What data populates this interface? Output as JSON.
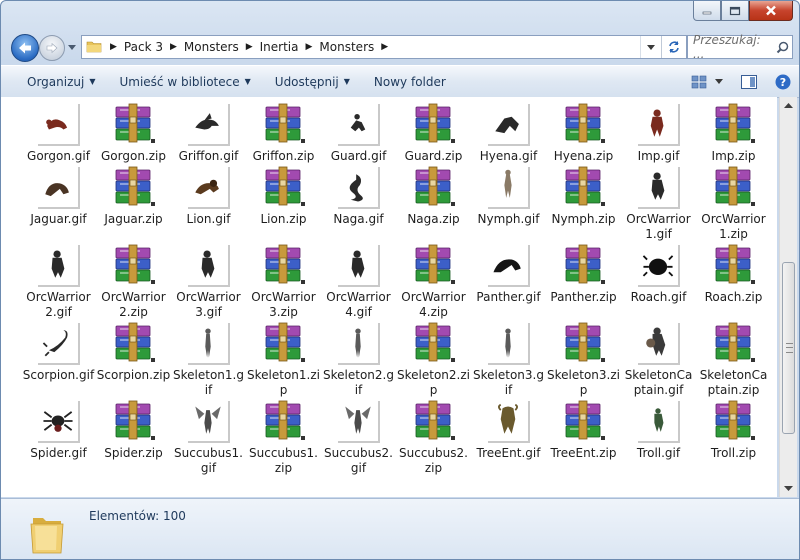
{
  "window": {
    "breadcrumb": [
      "Pack 3",
      "Monsters",
      "Inertia",
      "Monsters"
    ],
    "search_placeholder": "Przeszukaj: ...",
    "caption_buttons": [
      "minimize",
      "maximize",
      "close"
    ]
  },
  "toolbar": {
    "organize": "Organizuj",
    "library": "Umieść w bibliotece",
    "share": "Udostępnij",
    "new_folder": "Nowy folder"
  },
  "items": [
    {
      "label": "Gorgon.gif",
      "type": "gif",
      "icon": "gorgon-thumbnail"
    },
    {
      "label": "Gorgon.zip",
      "type": "zip",
      "icon": "winrar-archive-icon"
    },
    {
      "label": "Griffon.gif",
      "type": "gif",
      "icon": "griffon-thumbnail"
    },
    {
      "label": "Griffon.zip",
      "type": "zip",
      "icon": "winrar-archive-icon"
    },
    {
      "label": "Guard.gif",
      "type": "gif",
      "icon": "guard-thumbnail"
    },
    {
      "label": "Guard.zip",
      "type": "zip",
      "icon": "winrar-archive-icon"
    },
    {
      "label": "Hyena.gif",
      "type": "gif",
      "icon": "hyena-thumbnail"
    },
    {
      "label": "Hyena.zip",
      "type": "zip",
      "icon": "winrar-archive-icon"
    },
    {
      "label": "Imp.gif",
      "type": "gif",
      "icon": "imp-thumbnail"
    },
    {
      "label": "Imp.zip",
      "type": "zip",
      "icon": "winrar-archive-icon"
    },
    {
      "label": "Jaguar.gif",
      "type": "gif",
      "icon": "jaguar-thumbnail"
    },
    {
      "label": "Jaguar.zip",
      "type": "zip",
      "icon": "winrar-archive-icon"
    },
    {
      "label": "Lion.gif",
      "type": "gif",
      "icon": "lion-thumbnail"
    },
    {
      "label": "Lion.zip",
      "type": "zip",
      "icon": "winrar-archive-icon"
    },
    {
      "label": "Naga.gif",
      "type": "gif",
      "icon": "naga-thumbnail"
    },
    {
      "label": "Naga.zip",
      "type": "zip",
      "icon": "winrar-archive-icon"
    },
    {
      "label": "Nymph.gif",
      "type": "gif",
      "icon": "nymph-thumbnail"
    },
    {
      "label": "Nymph.zip",
      "type": "zip",
      "icon": "winrar-archive-icon"
    },
    {
      "label": "OrcWarrior1.gif",
      "type": "gif",
      "icon": "orcwarrior-thumbnail"
    },
    {
      "label": "OrcWarrior1.zip",
      "type": "zip",
      "icon": "winrar-archive-icon"
    },
    {
      "label": "OrcWarrior2.gif",
      "type": "gif",
      "icon": "orcwarrior-thumbnail"
    },
    {
      "label": "OrcWarrior2.zip",
      "type": "zip",
      "icon": "winrar-archive-icon"
    },
    {
      "label": "OrcWarrior3.gif",
      "type": "gif",
      "icon": "orcwarrior-thumbnail"
    },
    {
      "label": "OrcWarrior3.zip",
      "type": "zip",
      "icon": "winrar-archive-icon"
    },
    {
      "label": "OrcWarrior4.gif",
      "type": "gif",
      "icon": "orcwarrior-thumbnail"
    },
    {
      "label": "OrcWarrior4.zip",
      "type": "zip",
      "icon": "winrar-archive-icon"
    },
    {
      "label": "Panther.gif",
      "type": "gif",
      "icon": "panther-thumbnail"
    },
    {
      "label": "Panther.zip",
      "type": "zip",
      "icon": "winrar-archive-icon"
    },
    {
      "label": "Roach.gif",
      "type": "gif",
      "icon": "roach-thumbnail"
    },
    {
      "label": "Roach.zip",
      "type": "zip",
      "icon": "winrar-archive-icon"
    },
    {
      "label": "Scorpion.gif",
      "type": "gif",
      "icon": "scorpion-thumbnail"
    },
    {
      "label": "Scorpion.zip",
      "type": "zip",
      "icon": "winrar-archive-icon"
    },
    {
      "label": "Skeleton1.gif",
      "type": "gif",
      "icon": "skeleton-thumbnail"
    },
    {
      "label": "Skeleton1.zip",
      "type": "zip",
      "icon": "winrar-archive-icon"
    },
    {
      "label": "Skeleton2.gif",
      "type": "gif",
      "icon": "skeleton-thumbnail"
    },
    {
      "label": "Skeleton2.zip",
      "type": "zip",
      "icon": "winrar-archive-icon"
    },
    {
      "label": "Skeleton3.gif",
      "type": "gif",
      "icon": "skeleton-thumbnail"
    },
    {
      "label": "Skeleton3.zip",
      "type": "zip",
      "icon": "winrar-archive-icon"
    },
    {
      "label": "SkeletonCaptain.gif",
      "type": "gif",
      "icon": "skeleton-captain-thumbnail"
    },
    {
      "label": "SkeletonCaptain.zip",
      "type": "zip",
      "icon": "winrar-archive-icon"
    },
    {
      "label": "Spider.gif",
      "type": "gif",
      "icon": "spider-thumbnail"
    },
    {
      "label": "Spider.zip",
      "type": "zip",
      "icon": "winrar-archive-icon"
    },
    {
      "label": "Succubus1.gif",
      "type": "gif",
      "icon": "succubus-thumbnail"
    },
    {
      "label": "Succubus1.zip",
      "type": "zip",
      "icon": "winrar-archive-icon"
    },
    {
      "label": "Succubus2.gif",
      "type": "gif",
      "icon": "succubus-thumbnail"
    },
    {
      "label": "Succubus2.zip",
      "type": "zip",
      "icon": "winrar-archive-icon"
    },
    {
      "label": "TreeEnt.gif",
      "type": "gif",
      "icon": "treeent-thumbnail"
    },
    {
      "label": "TreeEnt.zip",
      "type": "zip",
      "icon": "winrar-archive-icon"
    },
    {
      "label": "Troll.gif",
      "type": "gif",
      "icon": "troll-thumbnail"
    },
    {
      "label": "Troll.zip",
      "type": "zip",
      "icon": "winrar-archive-icon"
    }
  ],
  "details": {
    "count": "Elementów: 100"
  },
  "colors": {
    "rar_purple": "#a24ab0",
    "rar_blue": "#3c5fc8",
    "rar_green": "#2e9a3a",
    "rar_strap": "#c89a3c",
    "creature": "#2a2a2a",
    "creature_red": "#7a2a1e"
  }
}
